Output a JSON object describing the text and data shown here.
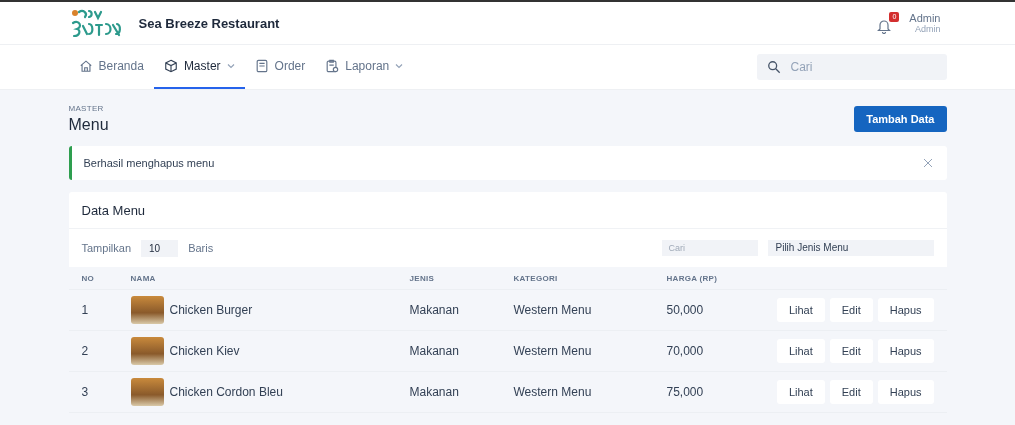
{
  "header": {
    "brand": "Sea Breeze Restaurant",
    "notification_count": "0",
    "user_name": "Admin",
    "user_role": "Admin"
  },
  "nav": {
    "items": [
      {
        "label": "Beranda",
        "dropdown": false,
        "selected": false
      },
      {
        "label": "Master",
        "dropdown": true,
        "selected": true
      },
      {
        "label": "Order",
        "dropdown": false,
        "selected": false
      },
      {
        "label": "Laporan",
        "dropdown": true,
        "selected": false
      }
    ],
    "search": {
      "placeholder": "Cari"
    }
  },
  "page": {
    "breadcrumb": "MASTER",
    "title": "Menu",
    "add_button": "Tambah Data"
  },
  "alert": {
    "message": "Berhasil menghapus menu"
  },
  "table_card": {
    "title": "Data Menu",
    "show_label": "Tampilkan",
    "page_size": "10",
    "rows_label": "Baris",
    "search": {
      "placeholder": "Cari"
    },
    "type_filter": {
      "value": "Pilih Jenis Menu"
    },
    "columns": [
      "NO",
      "NAMA",
      "JENIS",
      "KATEGORI",
      "HARGA (RP)"
    ],
    "rows": [
      {
        "no": "1",
        "name": "Chicken Burger",
        "type": "Makanan",
        "category": "Western Menu",
        "price": "50,000",
        "actions": [
          "Lihat",
          "Edit",
          "Hapus"
        ]
      },
      {
        "no": "2",
        "name": "Chicken Kiev",
        "type": "Makanan",
        "category": "Western Menu",
        "price": "70,000",
        "actions": [
          "Lihat",
          "Edit",
          "Hapus"
        ]
      },
      {
        "no": "3",
        "name": "Chicken Cordon Bleu",
        "type": "Makanan",
        "category": "Western Menu",
        "price": "75,000",
        "actions": [
          "Lihat",
          "Edit",
          "Hapus"
        ]
      }
    ]
  }
}
